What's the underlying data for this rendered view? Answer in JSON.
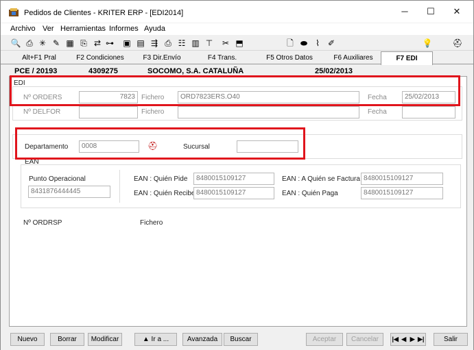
{
  "window": {
    "title": "Pedidos de Clientes - KRITER ERP - [EDI2014]",
    "minimize": "─",
    "maximize": "☐",
    "close": "✕"
  },
  "menu": [
    "Archivo",
    "Ver",
    "Herramientas",
    "Informes",
    "Ayuda"
  ],
  "tabs": [
    "Alt+F1 Pral",
    "F2 Condiciones",
    "F3 Dir.Envío",
    "F4 Trans.",
    "F5 Otros Datos",
    "F6 Auxiliares",
    "F7 EDI"
  ],
  "header": {
    "order": "PCE / 20193",
    "client_code": "4309275",
    "client_name": "SOCOMO, S.A. CATALUÑA",
    "date": "25/02/2013"
  },
  "edi": {
    "title": "EDI",
    "orders_label": "Nº ORDERS",
    "orders_value": "7823",
    "fichero_label": "Fichero",
    "fichero_value": "ORD7823ERS.O40",
    "fecha_label": "Fecha",
    "fecha_value": "25/02/2013",
    "delfor_label": "Nº DELFOR",
    "delfor_value": "",
    "fichero2_label": "Fichero",
    "fichero2_value": "",
    "fecha2_label": "Fecha",
    "fecha2_value": ""
  },
  "dept": {
    "departamento_label": "Departamento",
    "departamento_value": "0008",
    "sucursal_label": "Sucursal",
    "sucursal_value": ""
  },
  "ean": {
    "title": "EAN",
    "punto_label": "Punto Operacional",
    "punto_value": "8431876444445",
    "quien_pide_label": "EAN : Quién Pide",
    "quien_pide_value": "8480015109127",
    "quien_recibe_label": "EAN : Quién Recibe",
    "quien_recibe_value": "8480015109127",
    "a_quien_factura_label": "EAN : A Quién se Factura",
    "a_quien_factura_value": "8480015109127",
    "quien_paga_label": "EAN : Quién Paga",
    "quien_paga_value": "8480015109127"
  },
  "ordrsp": {
    "label": "Nº ORDRSP",
    "fichero_label": "Fichero"
  },
  "buttons": {
    "nuevo": "Nuevo",
    "borrar": "Borrar",
    "modificar": "Modificar",
    "ir_a": "▲ Ir a ...",
    "avanzada": "Avanzada",
    "buscar": "Buscar",
    "aceptar": "Aceptar",
    "cancelar": "Cancelar",
    "salir": "Salir"
  },
  "nav": [
    "|◀",
    "◀",
    "▶",
    "▶|"
  ],
  "colors": {
    "highlight": "#e0141c",
    "accent": "#b00000"
  }
}
